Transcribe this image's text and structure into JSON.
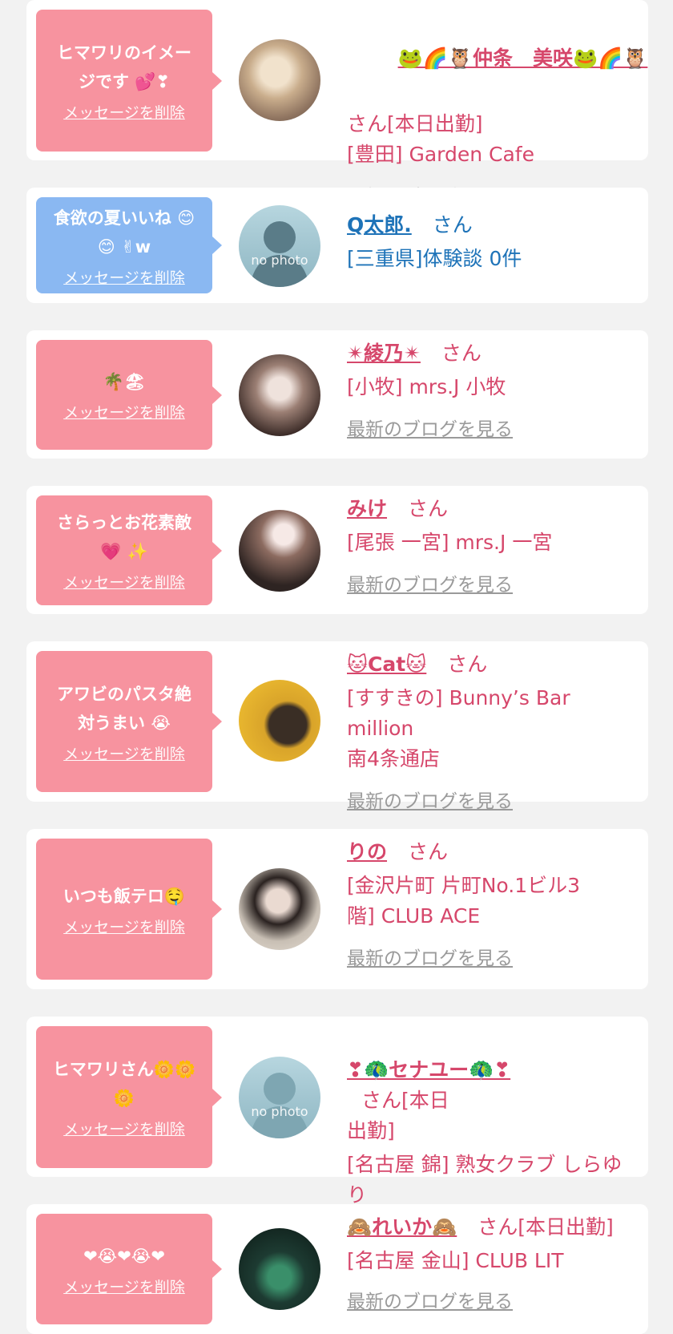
{
  "delete_label": "メッセージを削除",
  "blog_label": "最新のブログを見る",
  "colors": {
    "pink": "#f7939f",
    "blue": "#8ab8f2",
    "name_pink": "#d6476b",
    "name_blue": "#1e73b8",
    "link_gray": "#9a9a9a"
  },
  "cards": [
    {
      "message": "ヒマワリのイメー\nジです 💕❣",
      "bubble": "pink",
      "avatar_icon": "blond-woman-avatar",
      "name": "🐸🌈🦉仲条　美咲🐸🌈🦉",
      "san": "さん[本日出勤]",
      "location": "[豊田] Garden Cafe",
      "blog": true
    },
    {
      "message": "食欲の夏いいね 😊\n😊 ✌w",
      "bubble": "blue",
      "avatar_icon": "no-photo-avatar",
      "avatar_text": "no photo",
      "name": "Q太郎.",
      "san": "さん",
      "location": "[三重県]体験談 0件",
      "blog": false
    },
    {
      "message": "🌴🏖",
      "bubble": "pink",
      "avatar_icon": "woman-avatar",
      "name": "✴綾乃✴",
      "san": "さん",
      "location": "[小牧] mrs.J 小牧",
      "blog": true
    },
    {
      "message": "さらっとお花素敵\n💗 ✨",
      "bubble": "pink",
      "avatar_icon": "woman-avatar",
      "name": "みけ",
      "san": "さん",
      "location": "[尾張 一宮] mrs.J 一宮",
      "blog": true
    },
    {
      "message": "アワビのパスタ絶\n対うまい 😭",
      "bubble": "pink",
      "avatar_icon": "bunny-bar-avatar",
      "name": "🐱Cat🐱",
      "san": "さん",
      "location": "[すすきの] Bunny’s Bar million\n南4条通店",
      "blog": true
    },
    {
      "message": "いつも飯テロ🤤",
      "bubble": "pink",
      "avatar_icon": "woman-avatar",
      "name": "りの",
      "san": "さん",
      "location": "[金沢片町 片町No.1ビル3\n階] CLUB ACE",
      "blog": true
    },
    {
      "message": "ヒマワリさん🌼🌼\n🌼",
      "bubble": "pink",
      "avatar_icon": "no-photo-avatar",
      "avatar_text": "no photo",
      "name": "❣🦚セナユー🦚❣",
      "san": "さん[本日\n出勤]",
      "location": "[名古屋 錦] 熟女クラブ しらゆり",
      "blog": true
    },
    {
      "message": "❤😭❤😭❤",
      "bubble": "pink",
      "avatar_icon": "woman-avatar",
      "name": "🙈れいか🙈",
      "san": "さん[本日出勤]",
      "location": "[名古屋 金山] CLUB LIT",
      "blog": true
    }
  ]
}
